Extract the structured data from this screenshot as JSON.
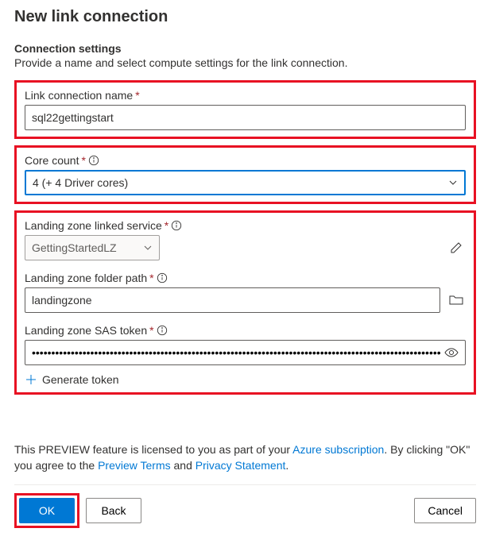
{
  "title": "New link connection",
  "section": {
    "heading": "Connection settings",
    "desc": "Provide a name and select compute settings for the link connection."
  },
  "fields": {
    "linkName": {
      "label": "Link connection name",
      "value": "sql22gettingstart"
    },
    "coreCount": {
      "label": "Core count",
      "value": "4 (+ 4 Driver cores)"
    },
    "lzService": {
      "label": "Landing zone linked service",
      "value": "GettingStartedLZ"
    },
    "lzFolder": {
      "label": "Landing zone folder path",
      "value": "landingzone"
    },
    "lzSas": {
      "label": "Landing zone SAS token",
      "value": "•••••••••••••••••••••••••••••••••••••••••••••••••••••••••••••••••••••••••••••••••••••••••••••••••••••••••••••••••••••••••••••••••…"
    },
    "generateToken": "Generate token"
  },
  "preview": {
    "t1": "This PREVIEW feature is licensed to you as part of your ",
    "link1": "Azure subscription",
    "t2": ". By clicking \"OK\" you agree to the ",
    "link2": "Preview Terms",
    "t3": " and ",
    "link3": "Privacy Statement",
    "t4": "."
  },
  "buttons": {
    "ok": "OK",
    "back": "Back",
    "cancel": "Cancel"
  }
}
